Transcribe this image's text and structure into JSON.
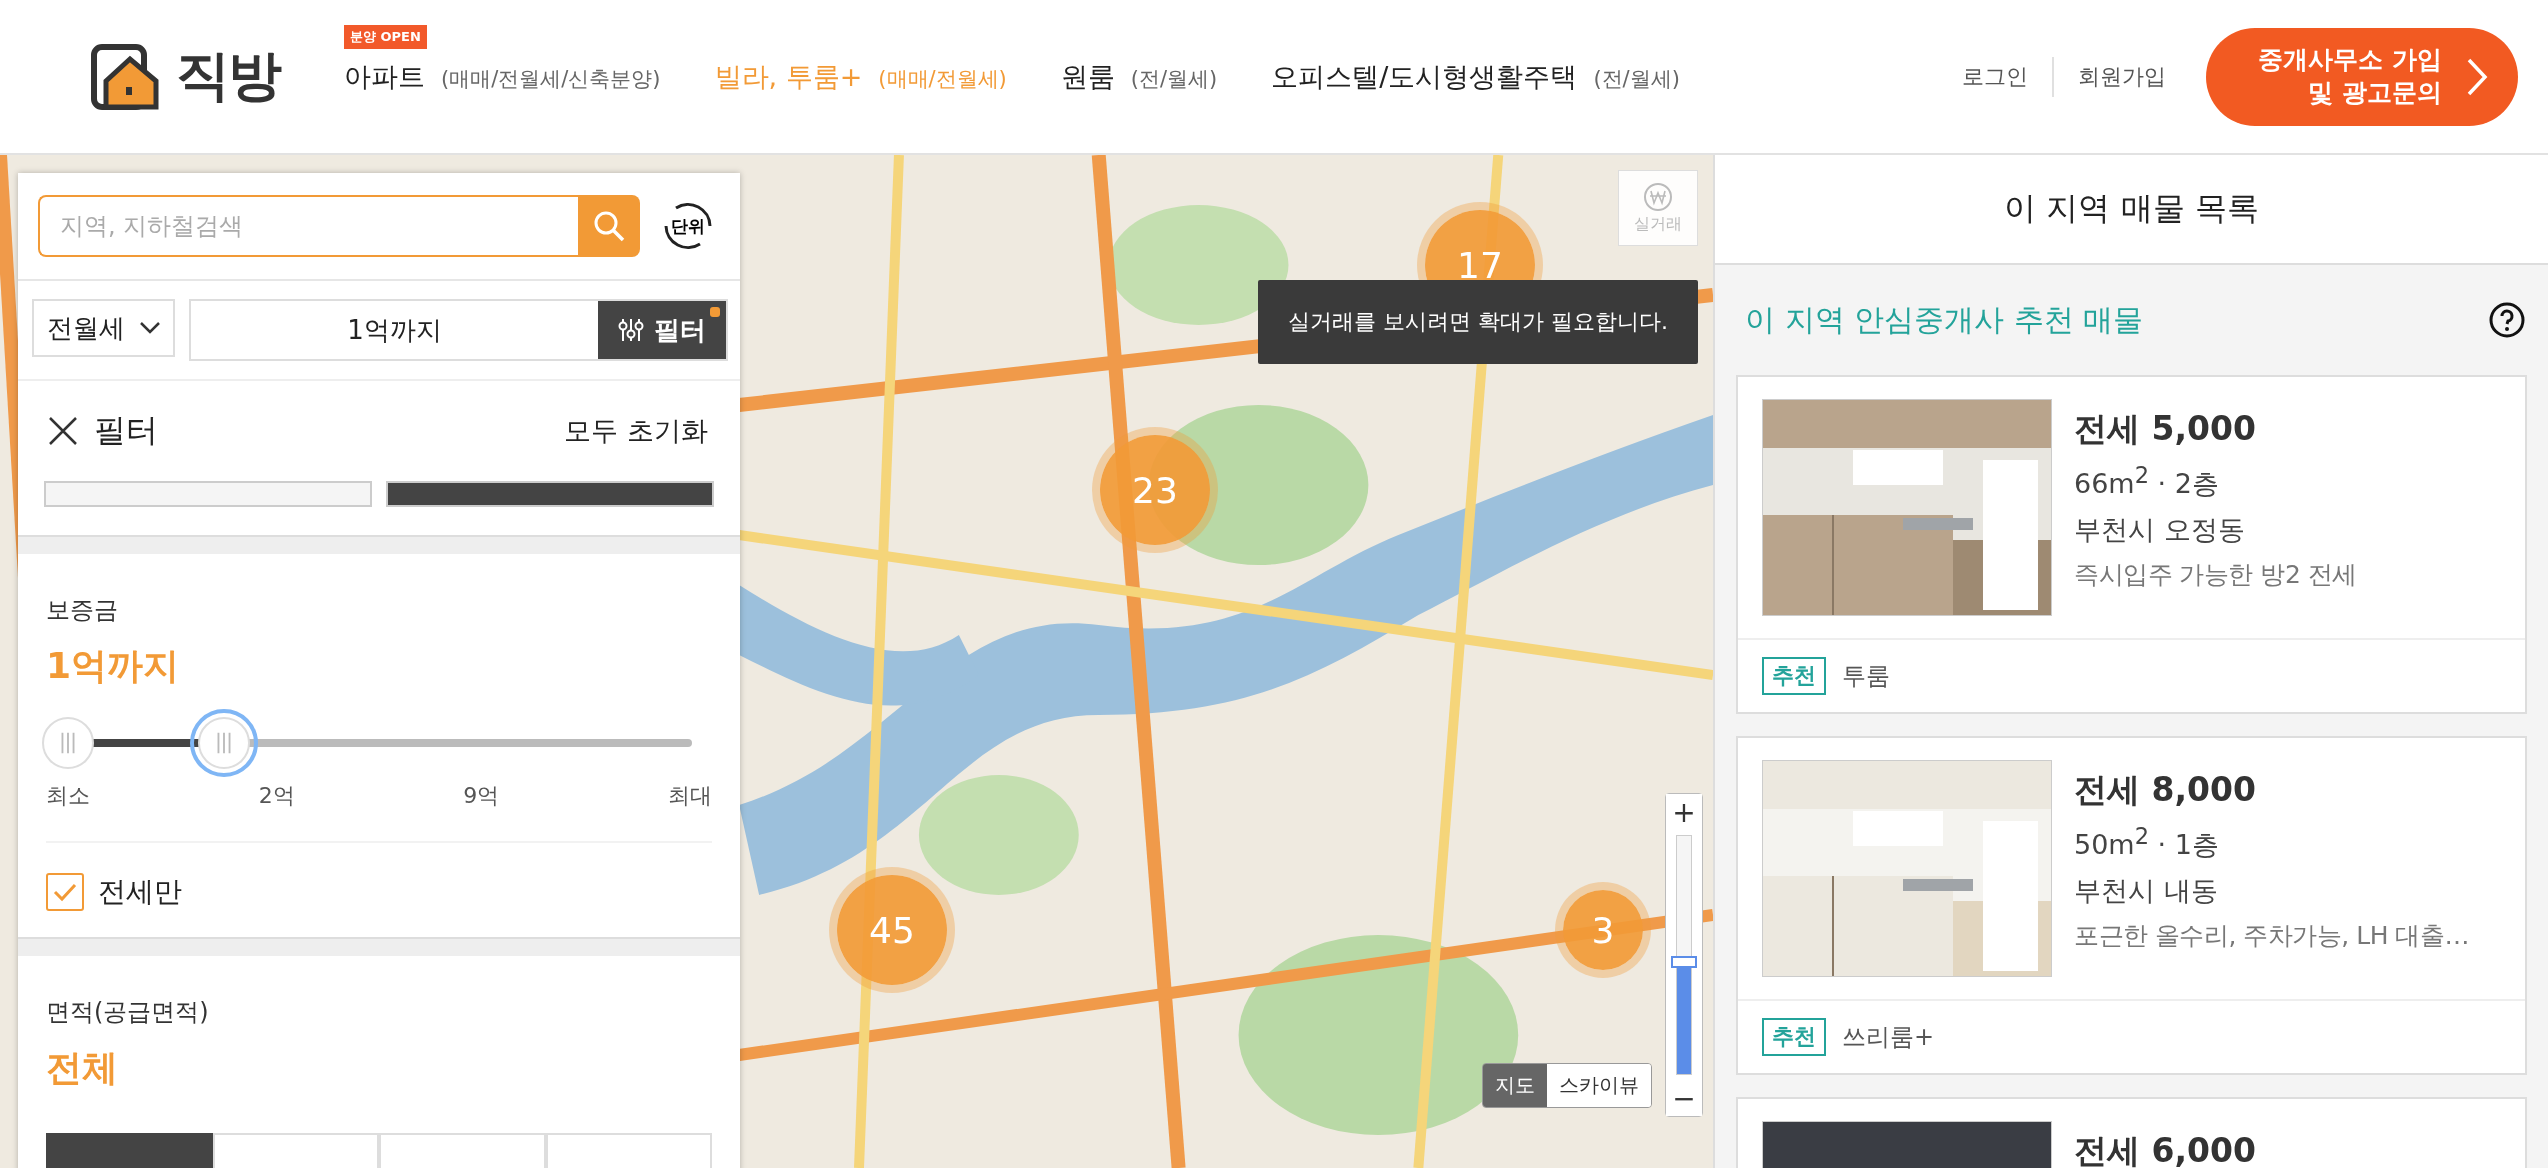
{
  "header": {
    "logo": "직방",
    "nav": [
      {
        "badge": "분양 OPEN",
        "label": "아파트",
        "sub": "(매매/전월세/신축분양)",
        "selected": false
      },
      {
        "label": "빌라, 투룸+",
        "sub": "(매매/전월세)",
        "selected": true
      },
      {
        "label": "원룸",
        "sub": "(전/월세)",
        "selected": false
      },
      {
        "label": "오피스텔/도시형생활주택",
        "sub": "(전/월세)",
        "selected": false
      }
    ],
    "login": "로그인",
    "signup": "회원가입",
    "cta": [
      "중개사무소 가입",
      "및 광고문의"
    ]
  },
  "search_bar": {
    "placeholder": "지역, 지하철검색",
    "unit_button": "단위",
    "deal_type": "전월세",
    "price_range": "1억까지",
    "filter_button": {
      "label": "필터",
      "active": true
    }
  },
  "filter_panel": {
    "title": "필터",
    "reset": "모두 초기화",
    "trade_toggle": [
      {
        "selected": false
      },
      {
        "selected": true
      }
    ],
    "deposit": {
      "label": "보증금",
      "value": "1억까지",
      "level": 0.25,
      "ticks": [
        "최소",
        "2억",
        "9억",
        "최대"
      ]
    },
    "jeonse_only": {
      "label": "전세만",
      "checked": true
    },
    "area": {
      "label": "면적(공급면적)",
      "value": "전체",
      "options": [
        {
          "selected": true
        },
        {
          "selected": false
        },
        {
          "selected": false
        },
        {
          "selected": false
        }
      ]
    }
  },
  "map_overlay": {
    "real_price_button": {
      "label": "실거래",
      "disabled": true
    },
    "tooltip": "실거래를 보시려면 확대가 필요합니다.",
    "clusters": [
      {
        "count": "17"
      },
      {
        "count": "23"
      },
      {
        "count": "45"
      },
      {
        "count": "3"
      }
    ],
    "zoom": {
      "plus": "+",
      "minus": "−",
      "level": 0.47
    },
    "map_types": [
      {
        "label": "지도",
        "selected": true
      },
      {
        "label": "스카이뷰",
        "selected": false
      }
    ]
  },
  "listing_panel": {
    "title": "이 지역 매물 목록",
    "section_title": "이 지역 안심중개사 추천 매물",
    "listings": [
      {
        "price": "전세 5,000",
        "area": "66m$^{2}$ · 2층",
        "location": "부천시 오정동",
        "description": "즉시입주 가능한 방2 전세",
        "tag": "추천",
        "room_type": "투룸"
      },
      {
        "price": "전세 8,000",
        "area": "50m$^{2}$ · 1층",
        "location": "부천시 내동",
        "description": "포근한 올수리, 주차가능, LH 대출…",
        "tag": "추천",
        "room_type": "쓰리룸+"
      },
      {
        "price": "전세 6,000"
      }
    ]
  }
}
